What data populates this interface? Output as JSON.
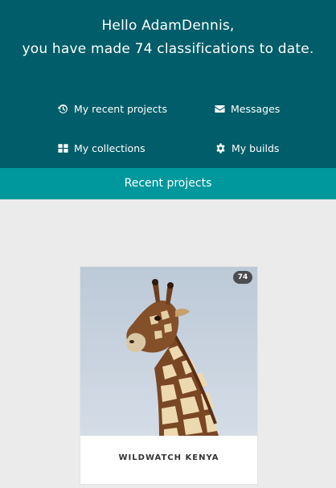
{
  "header": {
    "greeting_line1": "Hello AdamDennis,",
    "greeting_line2": "you have made 74 classifications to date."
  },
  "nav": {
    "recent_projects": {
      "label": "My recent projects",
      "icon": "history-icon"
    },
    "messages": {
      "label": "Messages",
      "icon": "envelope-icon"
    },
    "collections": {
      "label": "My collections",
      "icon": "grid-icon"
    },
    "builds": {
      "label": "My builds",
      "icon": "gear-icon"
    }
  },
  "tab": {
    "label": "Recent projects"
  },
  "projects": [
    {
      "title": "WILDWATCH KENYA",
      "classifications": "74",
      "image": "giraffe-photo"
    }
  ],
  "colors": {
    "header_bg": "#005d69",
    "tab_bg": "#00979d",
    "page_bg": "#ebebeb",
    "badge_bg": "#4a4e50"
  }
}
